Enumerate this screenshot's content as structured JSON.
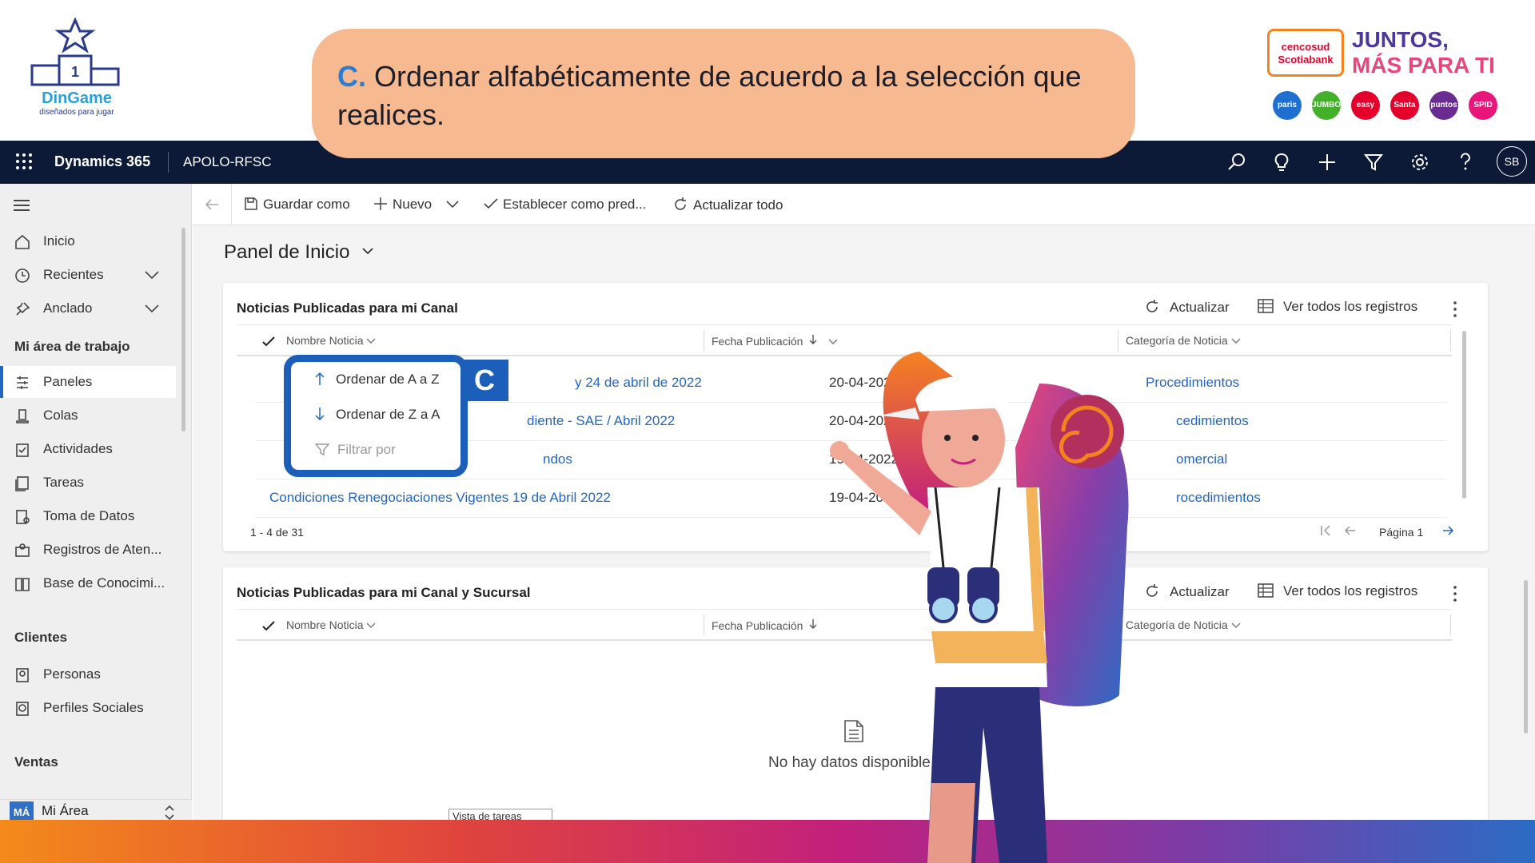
{
  "banner": {
    "dingame_name": "DinGame",
    "dingame_tagline": "diseñados para jugar",
    "dingame_badge_number": "1",
    "instruction_letter": "C.",
    "instruction_text": "Ordenar alfabéticamente de acuerdo a la selección que realices.",
    "cencosud_line1": "cencosud",
    "cencosud_line2": "Scotiabank",
    "slogan_line1": "JUNTOS,",
    "slogan_line2": "MÁS PARA TI",
    "partners": [
      {
        "label": "paris",
        "color": "#1f6fd1"
      },
      {
        "label": "JUMBO",
        "color": "#43b02a"
      },
      {
        "label": "easy",
        "color": "#e4002b"
      },
      {
        "label": "Santa Isabel",
        "color": "#e4002b"
      },
      {
        "label": "puntos",
        "color": "#6a2c91"
      },
      {
        "label": "SPID",
        "color": "#e8157a"
      }
    ]
  },
  "topbar": {
    "app_name": "Dynamics 365",
    "environment": "APOLO-RFSC",
    "avatar_initials": "SB",
    "icons": [
      "search-icon",
      "lightbulb-icon",
      "plus-icon",
      "filter-icon",
      "gear-icon",
      "help-icon"
    ]
  },
  "sidebar": {
    "top_items": [
      {
        "label": "Inicio",
        "icon": "home-icon"
      },
      {
        "label": "Recientes",
        "icon": "clock-icon"
      },
      {
        "label": "Anclado",
        "icon": "pin-icon"
      }
    ],
    "section_workspace": "Mi área de trabajo",
    "workspace_items": [
      {
        "label": "Paneles",
        "icon": "dashboard-icon"
      },
      {
        "label": "Colas",
        "icon": "queue-icon"
      },
      {
        "label": "Actividades",
        "icon": "activities-icon"
      },
      {
        "label": "Tareas",
        "icon": "tasks-icon"
      },
      {
        "label": "Toma de Datos",
        "icon": "data-icon"
      },
      {
        "label": "Registros de Aten...",
        "icon": "records-icon"
      },
      {
        "label": "Base de Conocimi...",
        "icon": "book-icon"
      }
    ],
    "section_clients": "Clientes",
    "client_items": [
      {
        "label": "Personas",
        "icon": "person-icon"
      },
      {
        "label": "Perfiles Sociales",
        "icon": "social-profile-icon"
      }
    ],
    "section_sales": "Ventas",
    "area_badge": "MÁ",
    "area_label": "Mi Área"
  },
  "commandbar": {
    "save_as": "Guardar como",
    "new": "Nuevo",
    "set_default": "Establecer como pred...",
    "refresh_all": "Actualizar todo"
  },
  "main": {
    "page_title": "Panel de Inicio",
    "card1": {
      "title": "Noticias Publicadas para mi Canal",
      "refresh": "Actualizar",
      "view_all": "Ver todos los registros",
      "columns": [
        "Nombre Noticia",
        "Fecha Publicación",
        "Categoría de Noticia"
      ],
      "rows": [
        {
          "name": "y 24 de abril de 2022",
          "date": "20-04-2022 13:34",
          "category": "Procedimientos"
        },
        {
          "name": "diente - SAE / Abril 2022",
          "date": "20-04-2022 13:20",
          "category": "cedimientos"
        },
        {
          "name": "ndos",
          "date": "19-04-2022 17:38",
          "category": "omercial"
        },
        {
          "name": "Condiciones Renegociaciones Vigentes 19 de Abril 2022",
          "date": "19-04-2022 11:22",
          "category": "rocedimientos"
        }
      ],
      "count": "1 - 4 de 31",
      "page": "Página 1"
    },
    "card2": {
      "title": "Noticias Publicadas para mi Canal y Sucursal",
      "refresh": "Actualizar",
      "view_all": "Ver todos los registros",
      "columns": [
        "Nombre Noticia",
        "Fecha Publicación",
        "Categoría de Noticia"
      ],
      "empty": "No hay datos disponible"
    },
    "popup_menu": {
      "sort_az": "Ordenar de A a Z",
      "sort_za": "Ordenar de Z a A",
      "filter": "Filtrar por"
    },
    "callout_letter": "C",
    "hidden_tab": "Vista de tareas"
  }
}
